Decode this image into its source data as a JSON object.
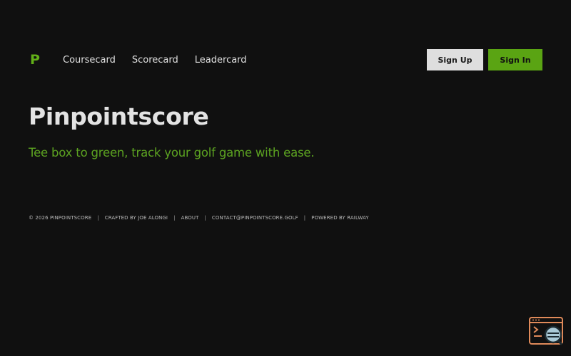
{
  "nav": {
    "logo_letter": "P",
    "links": [
      "Coursecard",
      "Scorecard",
      "Leadercard"
    ],
    "sign_up": "Sign Up",
    "sign_in": "Sign In"
  },
  "hero": {
    "title": "Pinpointscore",
    "tagline": "Tee box to green, track your golf game with ease."
  },
  "footer": {
    "copyright": "© 2026 PINPOINTSCORE",
    "credit": "CRAFTED BY JOE ALONGI",
    "about": "ABOUT",
    "contact": "CONTACT@PINPOINTSCORE.GOLF",
    "powered": "POWERED BY RAILWAY",
    "separator": "|"
  },
  "widget": {
    "icon": "inspect-window-icon"
  },
  "colors": {
    "background": "#101010",
    "accent_green": "#5aa413",
    "tagline_green": "#5ca321",
    "signup_bg": "#dedede",
    "widget_orange": "#e08a5a"
  }
}
